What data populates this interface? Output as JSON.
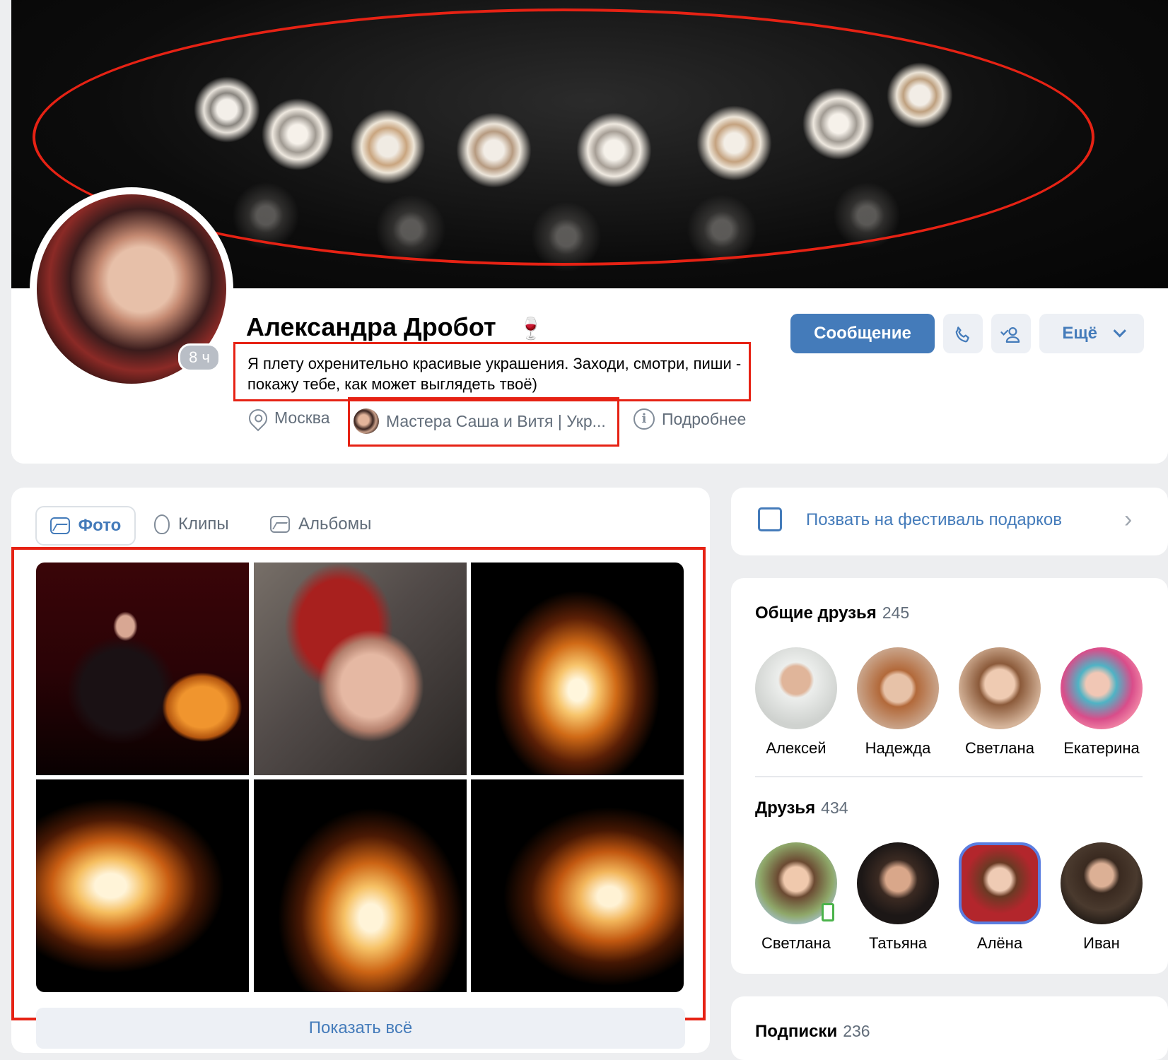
{
  "profile": {
    "name": "Александра Дробот",
    "name_emoji": "🍷",
    "status_badge": "8 ч",
    "bio": "Я плету охренительно красивые украшения. Заходи, смотри, пиши - покажу тебе, как может выглядеть твоё)",
    "city": "Москва",
    "job": "Мастера Саша и Витя | Укр...",
    "more_info": "Подробнее"
  },
  "actions": {
    "message": "Сообщение",
    "call_icon": "phone-icon",
    "friend_icon": "user-check-icon",
    "more": "Ещё"
  },
  "tabs": [
    {
      "label": "Фото",
      "icon": "photo-icon",
      "active": true
    },
    {
      "label": "Клипы",
      "icon": "clip-icon",
      "active": false
    },
    {
      "label": "Альбомы",
      "icon": "albums-icon",
      "active": false
    }
  ],
  "photos": {
    "show_all": "Показать всё"
  },
  "gift": {
    "label": "Позвать на фестиваль подарков"
  },
  "mutual_friends": {
    "title": "Общие друзья",
    "count": "245",
    "items": [
      {
        "name": "Алексей",
        "color": "#cfd2cf"
      },
      {
        "name": "Надежда",
        "color": "#c9a48a"
      },
      {
        "name": "Светлана",
        "color": "#d5b49a"
      },
      {
        "name": "Екатерина",
        "color": "#d94d8a"
      }
    ]
  },
  "friends": {
    "title": "Друзья",
    "count": "434",
    "items": [
      {
        "name": "Светлана",
        "color": "#8fa86a"
      },
      {
        "name": "Татьяна",
        "color": "#2a2624"
      },
      {
        "name": "Алёна",
        "color": "#b3262c"
      },
      {
        "name": "Иван",
        "color": "#4a3a2e"
      }
    ]
  },
  "subscriptions": {
    "title": "Подписки",
    "count": "236"
  },
  "colors": {
    "accent": "#447bba",
    "annotation_red": "#e62214"
  }
}
